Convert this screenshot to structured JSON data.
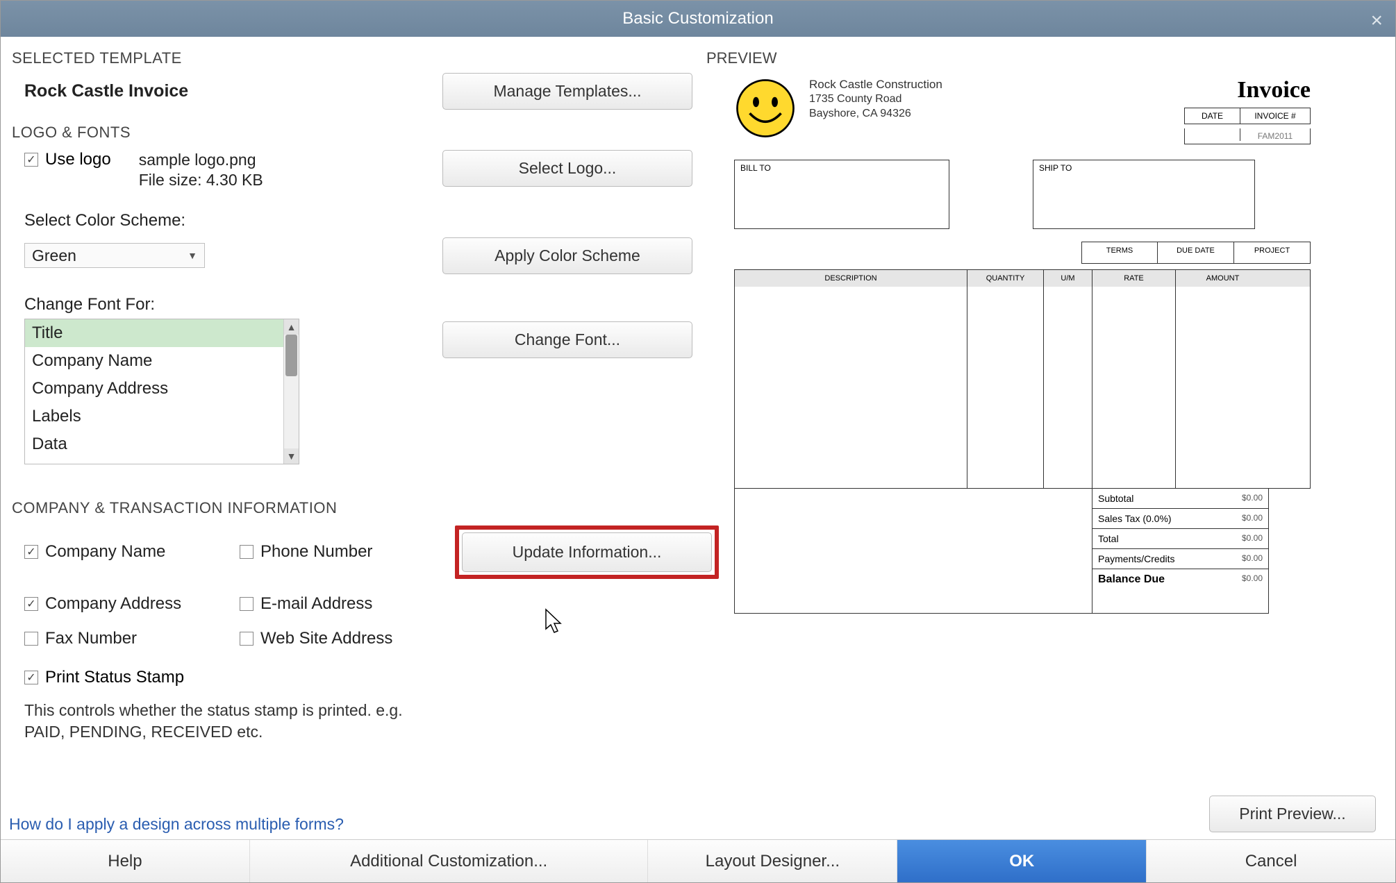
{
  "window": {
    "title": "Basic Customization"
  },
  "sections": {
    "selected_template": "SELECTED TEMPLATE",
    "logo_fonts": "LOGO & FONTS",
    "company_info": "COMPANY & TRANSACTION INFORMATION",
    "preview": "PREVIEW"
  },
  "template": {
    "name": "Rock Castle Invoice"
  },
  "buttons": {
    "manage_templates": "Manage Templates...",
    "select_logo": "Select Logo...",
    "apply_color_scheme": "Apply Color Scheme",
    "change_font": "Change Font...",
    "update_info": "Update Information...",
    "print_preview": "Print Preview...",
    "help": "Help",
    "additional_custom": "Additional Customization...",
    "layout_designer": "Layout Designer...",
    "ok": "OK",
    "cancel": "Cancel"
  },
  "logo": {
    "use_logo_label": "Use logo",
    "use_logo_checked": true,
    "file_name": "sample logo.png",
    "file_size": "File size: 4.30 KB"
  },
  "color_scheme": {
    "label": "Select Color Scheme:",
    "value": "Green"
  },
  "change_font": {
    "label": "Change Font For:",
    "items": [
      "Title",
      "Company Name",
      "Company Address",
      "Labels",
      "Data"
    ],
    "selected": "Title"
  },
  "company_checks": {
    "company_name": {
      "label": "Company Name",
      "checked": true
    },
    "phone": {
      "label": "Phone Number",
      "checked": false
    },
    "company_address": {
      "label": "Company Address",
      "checked": true
    },
    "email": {
      "label": "E-mail Address",
      "checked": false
    },
    "fax": {
      "label": "Fax Number",
      "checked": false
    },
    "web": {
      "label": "Web Site Address",
      "checked": false
    }
  },
  "status_stamp": {
    "label": "Print Status Stamp",
    "checked": true,
    "description_line1": "This controls whether the status stamp is printed. e.g.",
    "description_line2": "PAID, PENDING, RECEIVED etc."
  },
  "help_link": "How do I apply a design across multiple forms?",
  "preview": {
    "company_name": "Rock Castle Construction",
    "addr1": "1735 County Road",
    "addr2": "Bayshore, CA 94326",
    "title": "Invoice",
    "date_label": "DATE",
    "invno_label": "INVOICE #",
    "invno_value": "FAM2011",
    "bill_to": "BILL TO",
    "ship_to": "SHIP TO",
    "mid_cols": [
      "TERMS",
      "DUE DATE",
      "PROJECT"
    ],
    "item_cols": [
      "DESCRIPTION",
      "QUANTITY",
      "U/M",
      "RATE",
      "AMOUNT"
    ],
    "totals": {
      "subtotal_label": "Subtotal",
      "subtotal_val": "$0.00",
      "salestax_label": "Sales Tax  (0.0%)",
      "salestax_val": "$0.00",
      "total_label": "Total",
      "total_val": "$0.00",
      "payments_label": "Payments/Credits",
      "payments_val": "$0.00",
      "balance_label": "Balance Due",
      "balance_val": "$0.00"
    }
  }
}
